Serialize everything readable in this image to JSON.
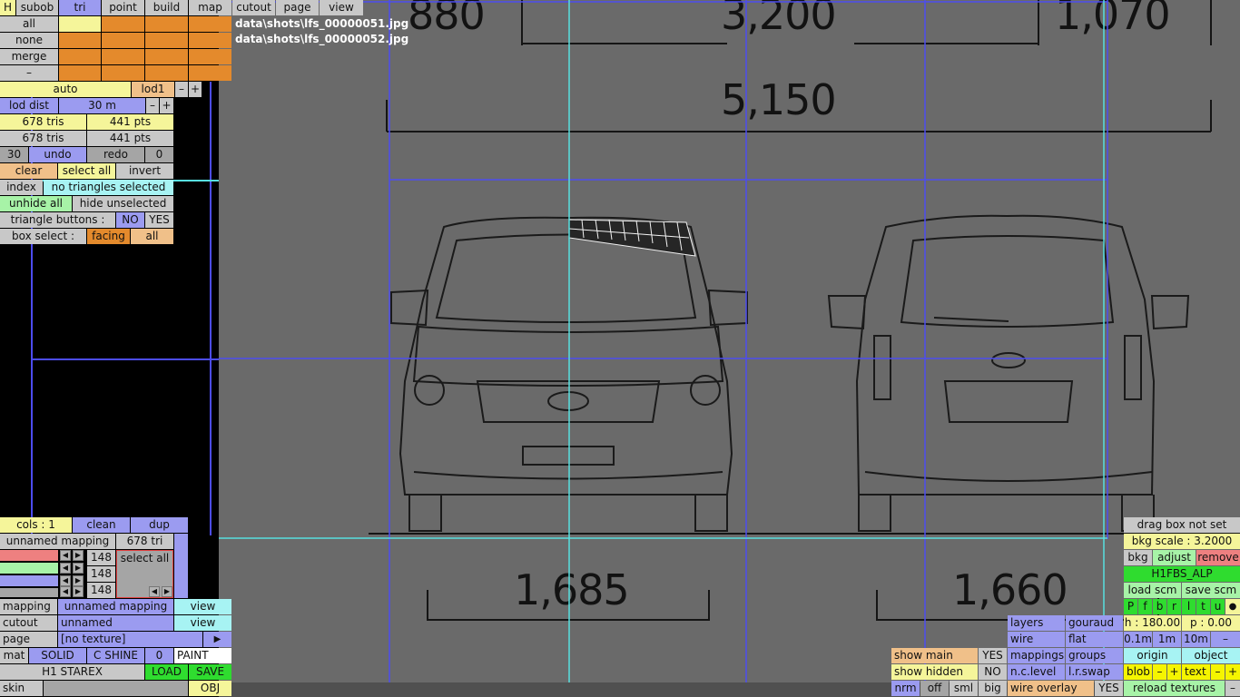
{
  "top_tabs": {
    "h": "H",
    "subob": "subob",
    "tri": "tri",
    "point": "point",
    "build": "build",
    "map": "map",
    "cutout": "cutout",
    "page": "page",
    "view": "view"
  },
  "left_rows": {
    "all": "all",
    "none": "none",
    "merge": "merge",
    "dash": "–"
  },
  "files": [
    "data\\shots\\lfs_00000051.jpg",
    "data\\shots\\lfs_00000052.jpg"
  ],
  "lod": {
    "auto": "auto",
    "lod1": "lod1",
    "minus": "–",
    "plus": "+",
    "lod_dist": "lod dist",
    "dist": "30 m"
  },
  "counts": {
    "tris1": "678 tris",
    "pts1": "441 pts",
    "tris2": "678 tris",
    "pts2": "441 pts"
  },
  "undo_row": {
    "n1": "30",
    "undo": "undo",
    "redo": "redo",
    "n2": "0"
  },
  "select_row": {
    "clear": "clear",
    "select_all": "select all",
    "invert": "invert"
  },
  "index_row": {
    "index": "index",
    "info": "no triangles selected"
  },
  "hide_row": {
    "unhide": "unhide all",
    "hide": "hide unselected"
  },
  "tri_buttons": {
    "label": "triangle buttons :",
    "no": "NO",
    "yes": "YES"
  },
  "box_select": {
    "label": "box select :",
    "facing": "facing",
    "all": "all"
  },
  "bottom_left": {
    "cols": "cols : 1",
    "clean": "clean",
    "dup": "dup",
    "mapping_name": "unnamed mapping",
    "tri_count": "678 tri",
    "c1": "148",
    "c2": "148",
    "c3": "148",
    "select_all": "select all",
    "mapping": "mapping",
    "mapping_val": "unnamed mapping",
    "view": "view",
    "cutout": "cutout",
    "cutout_val": "unnamed",
    "view2": "view",
    "page": "page",
    "page_val": "[no texture]",
    "play": "▶",
    "mat": "mat",
    "solid": "SOLID",
    "cshine": "C SHINE",
    "zero": "0",
    "paint": "PAINT",
    "model": "H1 STAREX",
    "load": "LOAD",
    "save": "SAVE",
    "skin": "skin",
    "obj": "OBJ"
  },
  "bottom_mid": {
    "show_main": "show main",
    "yes1": "YES",
    "show_hidden": "show hidden",
    "no1": "NO",
    "nrm": "nrm",
    "off": "off",
    "sml": "sml",
    "big": "big",
    "layers": "layers",
    "gouraud": "gouraud",
    "wire": "wire",
    "flat": "flat",
    "mappings": "mappings",
    "groups": "groups",
    "nclevel": "n.c.level",
    "lrswap": "l.r.swap",
    "wire_overlay": "wire overlay",
    "yes2": "YES"
  },
  "right_panel": {
    "drag": "drag box not set",
    "bkg_scale": "bkg scale : 3.2000",
    "bkg": "bkg",
    "adjust": "adjust",
    "remove": "remove",
    "name": "H1FBS_ALP",
    "load_scm": "load scm",
    "save_scm": "save scm",
    "views": [
      "P",
      "f",
      "b",
      "r",
      "l",
      "t",
      "u"
    ],
    "dot": "●",
    "h": "h : 180.00",
    "p": "p : 0.00",
    "s01": "0.1m",
    "s1": "1m",
    "s10": "10m",
    "dash": "–",
    "origin": "origin",
    "object": "object",
    "blob": "blob",
    "text": "text",
    "minus": "–",
    "plus": "+",
    "reload": "reload textures"
  },
  "blueprint": {
    "top_left": "880",
    "top_mid": "3,200",
    "top_right": "1,070",
    "total": "5,150",
    "front_width": "1,685",
    "rear_width": "1,660"
  }
}
